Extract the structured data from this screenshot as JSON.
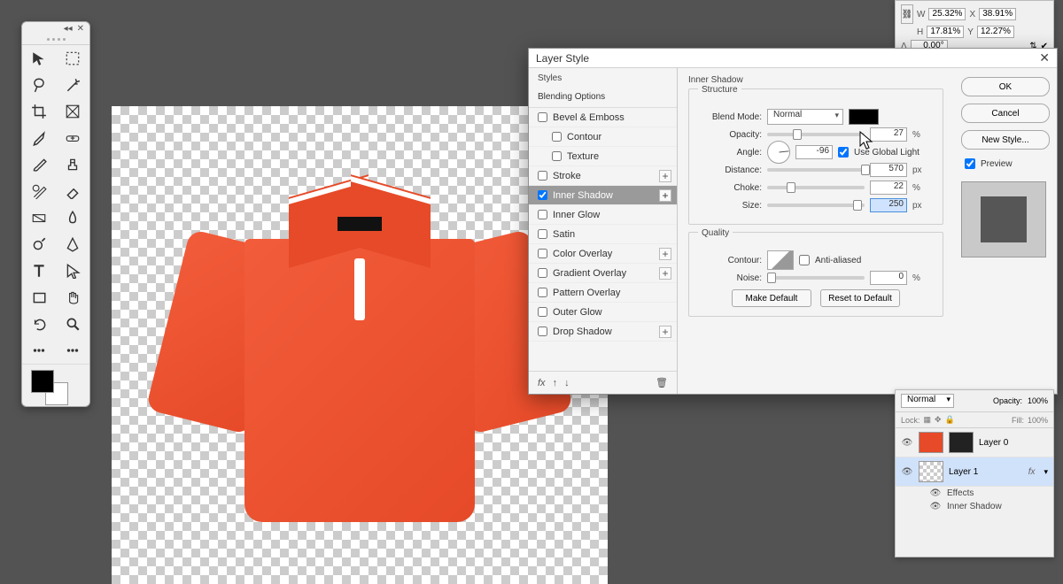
{
  "tools": {
    "icons": [
      "move-tool",
      "marquee-tool",
      "lasso-tool",
      "magic-wand-tool",
      "crop-tool",
      "frame-tool",
      "eyedropper-tool",
      "healing-brush-tool",
      "brush-tool",
      "clone-stamp-tool",
      "history-brush-tool",
      "eraser-tool",
      "gradient-tool",
      "blur-tool",
      "dodge-tool",
      "pen-tool",
      "type-tool",
      "path-selection-tool",
      "rectangle-tool",
      "hand-tool",
      "rotate-tool",
      "zoom-tool",
      "edit-toolbar-tool",
      "more-tools"
    ]
  },
  "optionsBar": {
    "w_label": "W",
    "w_value": "25.32%",
    "x_label": "X",
    "x_value": "38.91%",
    "h_label": "H",
    "h_value": "17.81%",
    "y_label": "Y",
    "y_value": "12.27%",
    "angle_label": "Δ",
    "angle_value": "0.00°"
  },
  "dialog": {
    "title": "Layer Style",
    "close": "✕",
    "sidebar": {
      "styles": "Styles",
      "blending": "Blending Options",
      "items": [
        {
          "label": "Bevel & Emboss",
          "checked": false,
          "plus": false
        },
        {
          "label": "Contour",
          "checked": false,
          "sub": true
        },
        {
          "label": "Texture",
          "checked": false,
          "sub": true
        },
        {
          "label": "Stroke",
          "checked": false,
          "plus": true
        },
        {
          "label": "Inner Shadow",
          "checked": true,
          "plus": true,
          "selected": true
        },
        {
          "label": "Inner Glow",
          "checked": false
        },
        {
          "label": "Satin",
          "checked": false
        },
        {
          "label": "Color Overlay",
          "checked": false,
          "plus": true
        },
        {
          "label": "Gradient Overlay",
          "checked": false,
          "plus": true
        },
        {
          "label": "Pattern Overlay",
          "checked": false
        },
        {
          "label": "Outer Glow",
          "checked": false
        },
        {
          "label": "Drop Shadow",
          "checked": false,
          "plus": true
        }
      ],
      "fx": "fx"
    },
    "main": {
      "heading": "Inner Shadow",
      "structure": "Structure",
      "blendMode_lbl": "Blend Mode:",
      "blendMode_val": "Normal",
      "opacity_lbl": "Opacity:",
      "opacity_val": "27",
      "opacity_unit": "%",
      "angle_lbl": "Angle:",
      "angle_val": "-96",
      "useGlobal": "Use Global Light",
      "distance_lbl": "Distance:",
      "distance_val": "570",
      "distance_unit": "px",
      "choke_lbl": "Choke:",
      "choke_val": "22",
      "choke_unit": "%",
      "size_lbl": "Size:",
      "size_val": "250",
      "size_unit": "px",
      "quality": "Quality",
      "contour_lbl": "Contour:",
      "antialias": "Anti-aliased",
      "noise_lbl": "Noise:",
      "noise_val": "0",
      "noise_unit": "%",
      "makeDefault": "Make Default",
      "resetDefault": "Reset to Default"
    },
    "actions": {
      "ok": "OK",
      "cancel": "Cancel",
      "newStyle": "New Style...",
      "preview": "Preview"
    }
  },
  "layersPanel": {
    "mode": "Normal",
    "opacity_lbl": "Opacity:",
    "opacity_val": "100%",
    "lock_lbl": "Lock:",
    "fill_lbl": "Fill:",
    "fill_val": "100%",
    "layers": [
      {
        "name": "Layer 0"
      },
      {
        "name": "Layer 1",
        "selected": true,
        "fx": "fx"
      }
    ],
    "effects": "Effects",
    "effectItem": "Inner Shadow"
  }
}
